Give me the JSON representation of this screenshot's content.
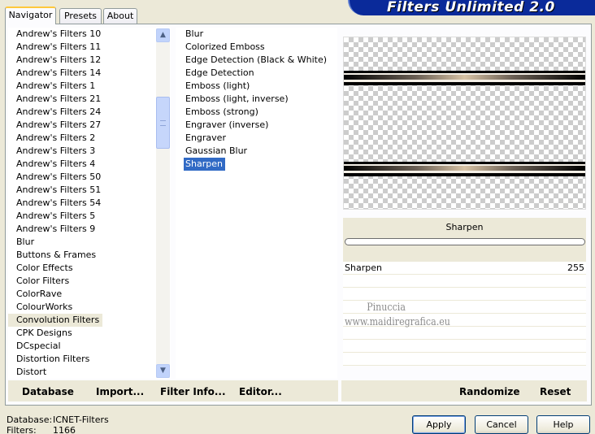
{
  "tabs": [
    {
      "label": "Navigator",
      "active": true
    },
    {
      "label": "Presets",
      "active": false
    },
    {
      "label": "About",
      "active": false
    }
  ],
  "banner": {
    "title": "Filters Unlimited 2.0"
  },
  "categories": [
    "Andrew's Filters 10",
    "Andrew's Filters 11",
    "Andrew's Filters 12",
    "Andrew's Filters 14",
    "Andrew's Filters 1",
    "Andrew's Filters 21",
    "Andrew's Filters 24",
    "Andrew's Filters 27",
    "Andrew's Filters 2",
    "Andrew's Filters 3",
    "Andrew's Filters 4",
    "Andrew's Filters 50",
    "Andrew's Filters 51",
    "Andrew's Filters 54",
    "Andrew's Filters 5",
    "Andrew's Filters 9",
    "Blur",
    "Buttons & Frames",
    "Color Effects",
    "Color Filters",
    "ColorRave",
    "ColourWorks",
    "Convolution Filters",
    "CPK Designs",
    "DCspecial",
    "Distortion Filters",
    "Distort"
  ],
  "selected_category": "Convolution Filters",
  "filters": [
    "Blur",
    "Colorized Emboss",
    "Edge Detection (Black & White)",
    "Edge Detection",
    "Emboss (light)",
    "Emboss (light, inverse)",
    "Emboss (strong)",
    "Engraver (inverse)",
    "Engraver",
    "Gaussian Blur",
    "Sharpen"
  ],
  "selected_filter": "Sharpen",
  "param_panel": {
    "title": "Sharpen",
    "params": [
      {
        "name": "Sharpen",
        "value": "255"
      }
    ]
  },
  "watermark": {
    "line1": "Pinuccia",
    "line2": "www.maidiregrafica.eu"
  },
  "panel_buttons": {
    "database": "Database",
    "import": "Import...",
    "filter_info": "Filter Info...",
    "editor": "Editor...",
    "randomize": "Randomize",
    "reset": "Reset"
  },
  "status": {
    "database_label": "Database:",
    "database_value": "ICNET-Filters",
    "filters_label": "Filters:",
    "filters_value": "1166"
  },
  "dialog_buttons": {
    "apply": "Apply",
    "cancel": "Cancel",
    "help": "Help"
  },
  "colors": {
    "selection": "#316ac5",
    "banner": "#0a2a9a",
    "tab_highlight": "#ffc83c"
  }
}
